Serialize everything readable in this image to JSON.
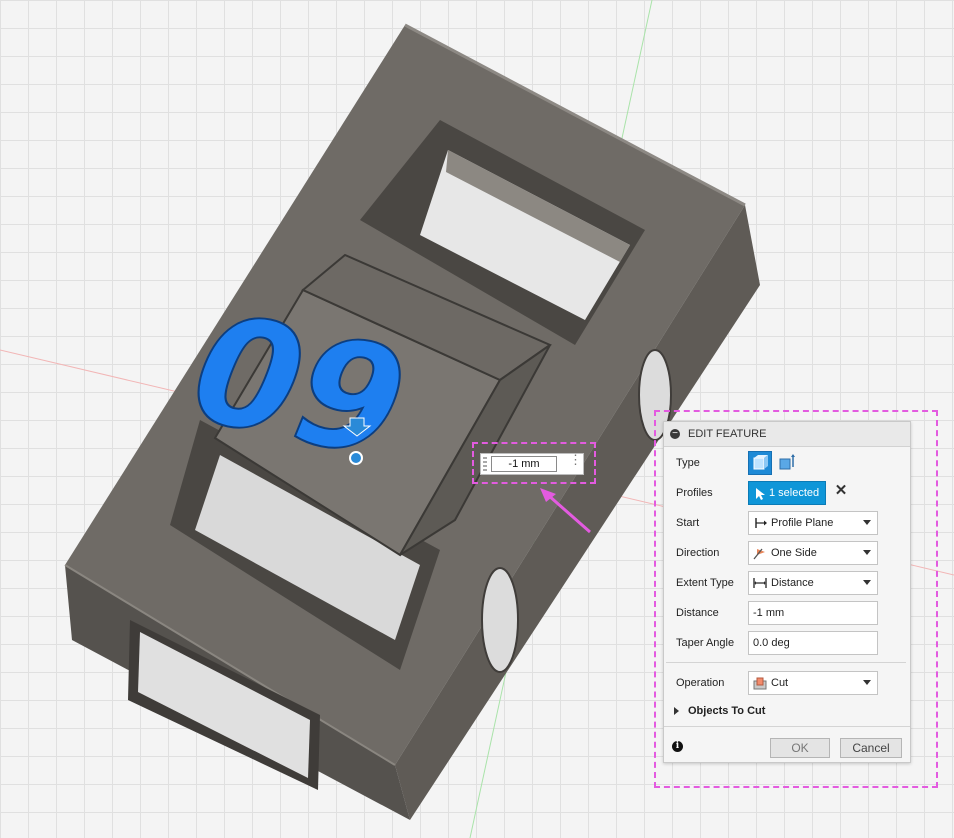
{
  "manipulator": {
    "distance_value": "-1 mm"
  },
  "panel": {
    "title": "EDIT FEATURE",
    "type_label": "Type",
    "profiles_label": "Profiles",
    "profiles_value": "1 selected",
    "start_label": "Start",
    "start_value": "Profile Plane",
    "direction_label": "Direction",
    "direction_value": "One Side",
    "extent_type_label": "Extent Type",
    "extent_type_value": "Distance",
    "distance_label": "Distance",
    "distance_value": "-1 mm",
    "taper_angle_label": "Taper Angle",
    "taper_angle_value": "0.0 deg",
    "operation_label": "Operation",
    "operation_value": "Cut",
    "objects_to_cut_label": "Objects To Cut",
    "ok_label": "OK",
    "cancel_label": "Cancel"
  },
  "model": {
    "engraved_text": "09"
  },
  "colors": {
    "accent": "#0f96d8",
    "highlight_annotation": "#e35be0",
    "selection_blue": "#1e7ff0",
    "body_gray": "#77736c"
  }
}
